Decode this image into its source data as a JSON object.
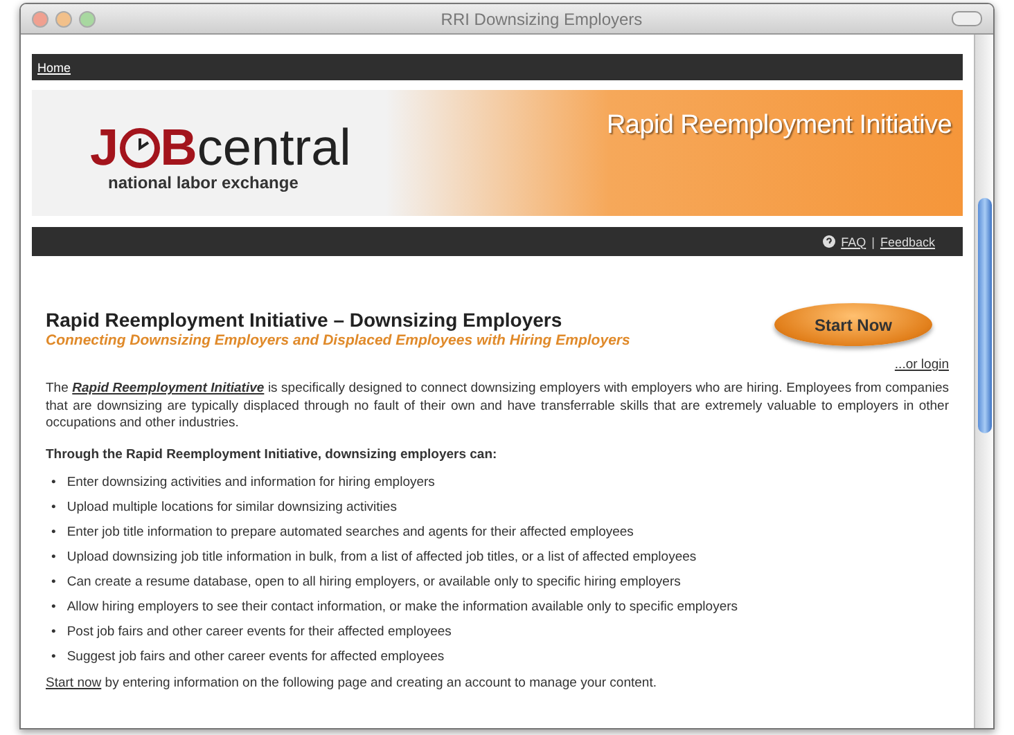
{
  "window": {
    "title": "RRI Downsizing Employers"
  },
  "nav": {
    "home_link": "Home"
  },
  "banner": {
    "logo": {
      "letter_1": "J",
      "letter_3": "B",
      "rest": "central",
      "tagline": "national labor exchange"
    },
    "title": "Rapid Reemployment Initiative"
  },
  "utility_bar": {
    "faq_link": "FAQ",
    "separator": "|",
    "feedback_link": "Feedback"
  },
  "content": {
    "heading": "Rapid Reemployment Initiative – Downsizing Employers",
    "subheading": "Connecting Downsizing Employers and Displaced Employees with Hiring Employers",
    "start_button": "Start Now",
    "login_link": "...or login",
    "intro": {
      "before": "The",
      "link": "Rapid Reemployment Initiative",
      "after": "is specifically designed to connect downsizing employers with employers who are hiring. Employees from companies that are downsizing are typically displaced through no fault of their own and have transferrable skills that are extremely valuable to employers in other occupations and other industries."
    },
    "list_heading": "Through the Rapid Reemployment Initiative, downsizing employers can:",
    "bullets": [
      {
        "marker": "•",
        "text": "Enter downsizing activities and information for hiring employers"
      },
      {
        "marker": "•",
        "text": "Upload multiple locations for similar downsizing activities"
      },
      {
        "marker": "•",
        "text": "Enter job title information to prepare automated searches and agents for their affected employees"
      },
      {
        "marker": "•",
        "text": "Upload downsizing job title information in bulk, from a list of affected job titles, or a list of affected employees"
      },
      {
        "marker": "•",
        "text": "Can create a resume database, open to all hiring employers, or available only to specific hiring employers"
      },
      {
        "marker": "•",
        "text": "Allow hiring employers to see their contact information, or make the information available only to specific employers"
      },
      {
        "marker": "•",
        "text": "Post job fairs and other career events for their affected employees"
      },
      {
        "marker": "•",
        "text": "Suggest job fairs and other career events for affected employees"
      }
    ],
    "closing": {
      "link": "Start now",
      "after": "by entering information on the following page and creating an account to manage your content."
    }
  }
}
